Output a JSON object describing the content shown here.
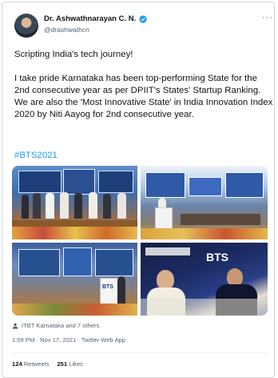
{
  "author": {
    "name": "Dr. Ashwathnarayan C. N.",
    "handle": "@drashwathcn"
  },
  "tweet": {
    "line1": "Scripting India's tech journey!",
    "line2": "I take pride Karnataka has been top-performing State for the 2nd consecutive year as per DPIIT's States' Startup Ranking. We are also the 'Most Innovative State' in India Innovation Index 2020 by Niti Aayog for 2nd consecutive year.",
    "hashtag": "#BTS2021"
  },
  "media": {
    "photo3_sign": "BTS",
    "photo4_sign": "BTS"
  },
  "tagged": "ITBT Karnataka and 7 others",
  "timestamp": "1:59 PM · Nov 17, 2021 · Twitter Web App",
  "stats": {
    "retweets_count": "124",
    "retweets_label": "Retweets",
    "likes_count": "251",
    "likes_label": "Likes"
  },
  "more_glyph": "···",
  "colors": {
    "accent": "#1d9bf0",
    "text": "#0f1419",
    "muted": "#536471"
  }
}
